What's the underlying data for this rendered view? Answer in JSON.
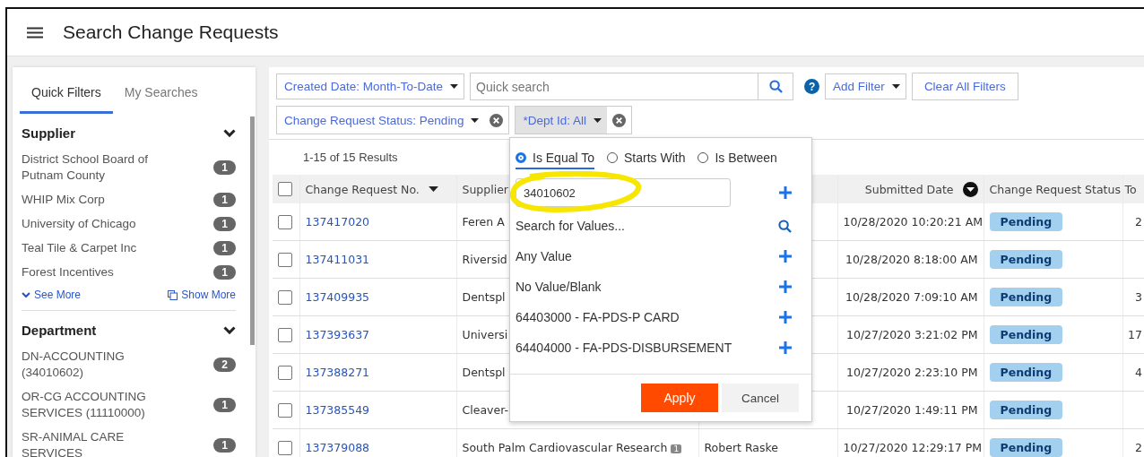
{
  "header": {
    "title": "Search Change Requests"
  },
  "sidebar": {
    "tabs": [
      {
        "label": "Quick Filters",
        "selected": true
      },
      {
        "label": "My Searches",
        "selected": false
      }
    ],
    "sections": [
      {
        "title": "Supplier",
        "expanded": true,
        "items": [
          {
            "label": "District School Board of Putnam County",
            "count": "1"
          },
          {
            "label": "WHIP Mix Corp",
            "count": "1"
          },
          {
            "label": "University of Chicago",
            "count": "1"
          },
          {
            "label": "Teal Tile & Carpet Inc",
            "count": "1"
          },
          {
            "label": "Forest Incentives",
            "count": "1"
          }
        ],
        "see_more": "See More",
        "show_more": "Show More"
      },
      {
        "title": "Department",
        "expanded": true,
        "items": [
          {
            "label": "DN-ACCOUNTING (34010602)",
            "count": "2"
          },
          {
            "label": "OR-CG ACCOUNTING SERVICES (11110000)",
            "count": "1"
          },
          {
            "label": "SR-ANIMAL CARE SERVICES",
            "count": "1"
          }
        ]
      }
    ]
  },
  "toolbar": {
    "date_filter": "Created Date: Month-To-Date",
    "search": {
      "placeholder": "Quick search"
    },
    "help": "?",
    "add_filter": "Add Filter",
    "clear_all": "Clear All Filters"
  },
  "active_filters": [
    {
      "label": "Change Request Status: Pending",
      "open": false
    },
    {
      "label": "*Dept Id: All",
      "open": true
    }
  ],
  "results": "1-15 of 15 Results",
  "table": {
    "select_all": {
      "checked": false
    },
    "columns": [
      {
        "label": "Change Request No.",
        "kind": "caret"
      },
      {
        "label": "Supplier",
        "kind": "plain"
      },
      {
        "label": "Submitted Date",
        "kind": "circle"
      },
      {
        "label": "Change Request Status",
        "kind": "plain"
      },
      {
        "label": "To",
        "kind": "plain"
      }
    ],
    "rows": [
      {
        "checked": false,
        "number": "137417020",
        "supplier": "Feren A",
        "date": "10/28/2020 10:20:21 AM",
        "status": "Pending",
        "column_6": "2"
      },
      {
        "checked": false,
        "number": "137411031",
        "supplier": "Riversid",
        "date": "10/28/2020 8:18:00 AM",
        "status": "Pending"
      },
      {
        "checked": false,
        "number": "137409935",
        "supplier": "Dentspl",
        "date": "10/28/2020 7:09:10 AM",
        "status": "Pending",
        "column_6": "3"
      },
      {
        "checked": false,
        "number": "137393637",
        "supplier": "Universi",
        "date": "10/27/2020 3:21:02 PM",
        "status": "Pending",
        "column_6": "17"
      },
      {
        "checked": false,
        "number": "137388271",
        "supplier": "Dentspl",
        "date": "10/27/2020 2:23:10 PM",
        "status": "Pending",
        "column_6": "4"
      },
      {
        "checked": false,
        "number": "137385549",
        "supplier": "Cleaver-",
        "date": "10/27/2020 1:49:11 PM",
        "status": "Pending"
      },
      {
        "checked": false,
        "number": "137379088",
        "supplier": "South Palm Cardiovascular Research",
        "supplier_badge": "1",
        "requester": "Robert Raske",
        "date": "10/27/2020 12:29:17 PM",
        "status": "Pending",
        "column_6": "2"
      }
    ]
  },
  "popup": {
    "options": [
      {
        "label": "Is Equal To",
        "selected": true
      },
      {
        "label": "Starts With",
        "selected": false
      },
      {
        "label": "Is Between",
        "selected": false
      }
    ],
    "value": "34010602",
    "items": [
      {
        "label": "Search for Values...",
        "kind": "search"
      },
      {
        "label": "Any Value",
        "kind": "add"
      },
      {
        "label": "No Value/Blank",
        "kind": "add"
      },
      {
        "label": "64403000 - FA-PDS-P CARD",
        "kind": "add"
      },
      {
        "label": "64404000 - FA-PDS-DISBURSEMENT",
        "kind": "add"
      }
    ],
    "apply": "Apply",
    "cancel": "Cancel"
  }
}
